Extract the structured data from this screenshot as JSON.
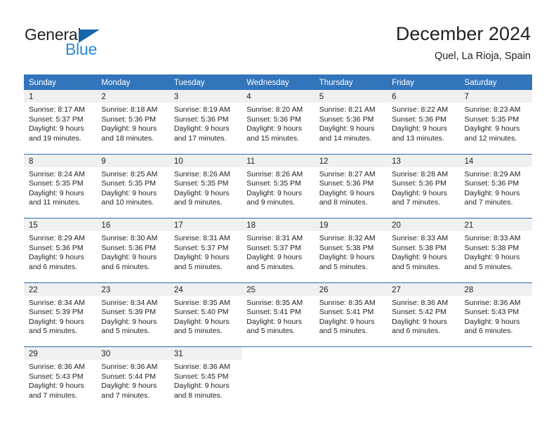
{
  "brand": {
    "name_part1": "General",
    "name_part2": "Blue",
    "triangle_color": "#1666ae",
    "blue_color": "#2b87d4"
  },
  "header": {
    "title": "December 2024",
    "subtitle": "Quel, La Rioja, Spain"
  },
  "theme": {
    "header_blue": "#3275bb",
    "separator_blue": "#2f6ca8",
    "daynum_band": "#f0f0f0",
    "text": "#222222"
  },
  "weekdays": [
    "Sunday",
    "Monday",
    "Tuesday",
    "Wednesday",
    "Thursday",
    "Friday",
    "Saturday"
  ],
  "weeks": [
    [
      {
        "day": "1",
        "l1": "Sunrise: 8:17 AM",
        "l2": "Sunset: 5:37 PM",
        "l3": "Daylight: 9 hours",
        "l4": "and 19 minutes."
      },
      {
        "day": "2",
        "l1": "Sunrise: 8:18 AM",
        "l2": "Sunset: 5:36 PM",
        "l3": "Daylight: 9 hours",
        "l4": "and 18 minutes."
      },
      {
        "day": "3",
        "l1": "Sunrise: 8:19 AM",
        "l2": "Sunset: 5:36 PM",
        "l3": "Daylight: 9 hours",
        "l4": "and 17 minutes."
      },
      {
        "day": "4",
        "l1": "Sunrise: 8:20 AM",
        "l2": "Sunset: 5:36 PM",
        "l3": "Daylight: 9 hours",
        "l4": "and 15 minutes."
      },
      {
        "day": "5",
        "l1": "Sunrise: 8:21 AM",
        "l2": "Sunset: 5:36 PM",
        "l3": "Daylight: 9 hours",
        "l4": "and 14 minutes."
      },
      {
        "day": "6",
        "l1": "Sunrise: 8:22 AM",
        "l2": "Sunset: 5:36 PM",
        "l3": "Daylight: 9 hours",
        "l4": "and 13 minutes."
      },
      {
        "day": "7",
        "l1": "Sunrise: 8:23 AM",
        "l2": "Sunset: 5:35 PM",
        "l3": "Daylight: 9 hours",
        "l4": "and 12 minutes."
      }
    ],
    [
      {
        "day": "8",
        "l1": "Sunrise: 8:24 AM",
        "l2": "Sunset: 5:35 PM",
        "l3": "Daylight: 9 hours",
        "l4": "and 11 minutes."
      },
      {
        "day": "9",
        "l1": "Sunrise: 8:25 AM",
        "l2": "Sunset: 5:35 PM",
        "l3": "Daylight: 9 hours",
        "l4": "and 10 minutes."
      },
      {
        "day": "10",
        "l1": "Sunrise: 8:26 AM",
        "l2": "Sunset: 5:35 PM",
        "l3": "Daylight: 9 hours",
        "l4": "and 9 minutes."
      },
      {
        "day": "11",
        "l1": "Sunrise: 8:26 AM",
        "l2": "Sunset: 5:35 PM",
        "l3": "Daylight: 9 hours",
        "l4": "and 9 minutes."
      },
      {
        "day": "12",
        "l1": "Sunrise: 8:27 AM",
        "l2": "Sunset: 5:36 PM",
        "l3": "Daylight: 9 hours",
        "l4": "and 8 minutes."
      },
      {
        "day": "13",
        "l1": "Sunrise: 8:28 AM",
        "l2": "Sunset: 5:36 PM",
        "l3": "Daylight: 9 hours",
        "l4": "and 7 minutes."
      },
      {
        "day": "14",
        "l1": "Sunrise: 8:29 AM",
        "l2": "Sunset: 5:36 PM",
        "l3": "Daylight: 9 hours",
        "l4": "and 7 minutes."
      }
    ],
    [
      {
        "day": "15",
        "l1": "Sunrise: 8:29 AM",
        "l2": "Sunset: 5:36 PM",
        "l3": "Daylight: 9 hours",
        "l4": "and 6 minutes."
      },
      {
        "day": "16",
        "l1": "Sunrise: 8:30 AM",
        "l2": "Sunset: 5:36 PM",
        "l3": "Daylight: 9 hours",
        "l4": "and 6 minutes."
      },
      {
        "day": "17",
        "l1": "Sunrise: 8:31 AM",
        "l2": "Sunset: 5:37 PM",
        "l3": "Daylight: 9 hours",
        "l4": "and 5 minutes."
      },
      {
        "day": "18",
        "l1": "Sunrise: 8:31 AM",
        "l2": "Sunset: 5:37 PM",
        "l3": "Daylight: 9 hours",
        "l4": "and 5 minutes."
      },
      {
        "day": "19",
        "l1": "Sunrise: 8:32 AM",
        "l2": "Sunset: 5:38 PM",
        "l3": "Daylight: 9 hours",
        "l4": "and 5 minutes."
      },
      {
        "day": "20",
        "l1": "Sunrise: 8:33 AM",
        "l2": "Sunset: 5:38 PM",
        "l3": "Daylight: 9 hours",
        "l4": "and 5 minutes."
      },
      {
        "day": "21",
        "l1": "Sunrise: 8:33 AM",
        "l2": "Sunset: 5:38 PM",
        "l3": "Daylight: 9 hours",
        "l4": "and 5 minutes."
      }
    ],
    [
      {
        "day": "22",
        "l1": "Sunrise: 8:34 AM",
        "l2": "Sunset: 5:39 PM",
        "l3": "Daylight: 9 hours",
        "l4": "and 5 minutes."
      },
      {
        "day": "23",
        "l1": "Sunrise: 8:34 AM",
        "l2": "Sunset: 5:39 PM",
        "l3": "Daylight: 9 hours",
        "l4": "and 5 minutes."
      },
      {
        "day": "24",
        "l1": "Sunrise: 8:35 AM",
        "l2": "Sunset: 5:40 PM",
        "l3": "Daylight: 9 hours",
        "l4": "and 5 minutes."
      },
      {
        "day": "25",
        "l1": "Sunrise: 8:35 AM",
        "l2": "Sunset: 5:41 PM",
        "l3": "Daylight: 9 hours",
        "l4": "and 5 minutes."
      },
      {
        "day": "26",
        "l1": "Sunrise: 8:35 AM",
        "l2": "Sunset: 5:41 PM",
        "l3": "Daylight: 9 hours",
        "l4": "and 5 minutes."
      },
      {
        "day": "27",
        "l1": "Sunrise: 8:36 AM",
        "l2": "Sunset: 5:42 PM",
        "l3": "Daylight: 9 hours",
        "l4": "and 6 minutes."
      },
      {
        "day": "28",
        "l1": "Sunrise: 8:36 AM",
        "l2": "Sunset: 5:43 PM",
        "l3": "Daylight: 9 hours",
        "l4": "and 6 minutes."
      }
    ],
    [
      {
        "day": "29",
        "l1": "Sunrise: 8:36 AM",
        "l2": "Sunset: 5:43 PM",
        "l3": "Daylight: 9 hours",
        "l4": "and 7 minutes."
      },
      {
        "day": "30",
        "l1": "Sunrise: 8:36 AM",
        "l2": "Sunset: 5:44 PM",
        "l3": "Daylight: 9 hours",
        "l4": "and 7 minutes."
      },
      {
        "day": "31",
        "l1": "Sunrise: 8:36 AM",
        "l2": "Sunset: 5:45 PM",
        "l3": "Daylight: 9 hours",
        "l4": "and 8 minutes."
      },
      {
        "day": "",
        "l1": "",
        "l2": "",
        "l3": "",
        "l4": ""
      },
      {
        "day": "",
        "l1": "",
        "l2": "",
        "l3": "",
        "l4": ""
      },
      {
        "day": "",
        "l1": "",
        "l2": "",
        "l3": "",
        "l4": ""
      },
      {
        "day": "",
        "l1": "",
        "l2": "",
        "l3": "",
        "l4": ""
      }
    ]
  ]
}
